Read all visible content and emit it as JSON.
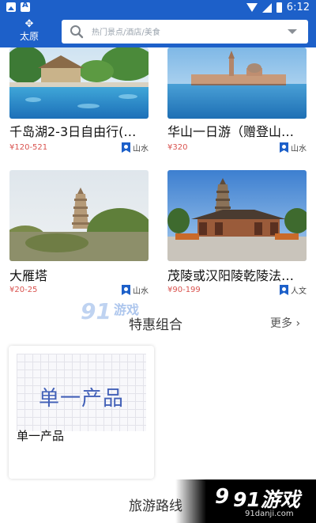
{
  "status_bar": {
    "time": "6:12"
  },
  "header": {
    "location_label": "太原",
    "search_placeholder": "热门景点/酒店/美食"
  },
  "cards": [
    {
      "title": "千岛湖2-3日自由行(…",
      "price": "¥120-521",
      "tag": "山水"
    },
    {
      "title": "华山一日游（赠登山…",
      "price": "¥320",
      "tag": "山水"
    },
    {
      "title": "大雁塔",
      "price": "¥20-25",
      "tag": "山水"
    },
    {
      "title": "茂陵或汉阳陵乾陵法…",
      "price": "¥90-199",
      "tag": "人文"
    }
  ],
  "specials": {
    "title": "特惠组合",
    "more_label": "更多 ›",
    "items": [
      {
        "image_text": "单一产品",
        "label": "单一产品"
      }
    ]
  },
  "routes": {
    "title": "旅游路线"
  },
  "watermark": {
    "brand": "91游戏",
    "url": "91danji.com",
    "logo_text": "91游戏"
  },
  "colors": {
    "primary": "#1d60c9",
    "price": "#d9534f"
  }
}
